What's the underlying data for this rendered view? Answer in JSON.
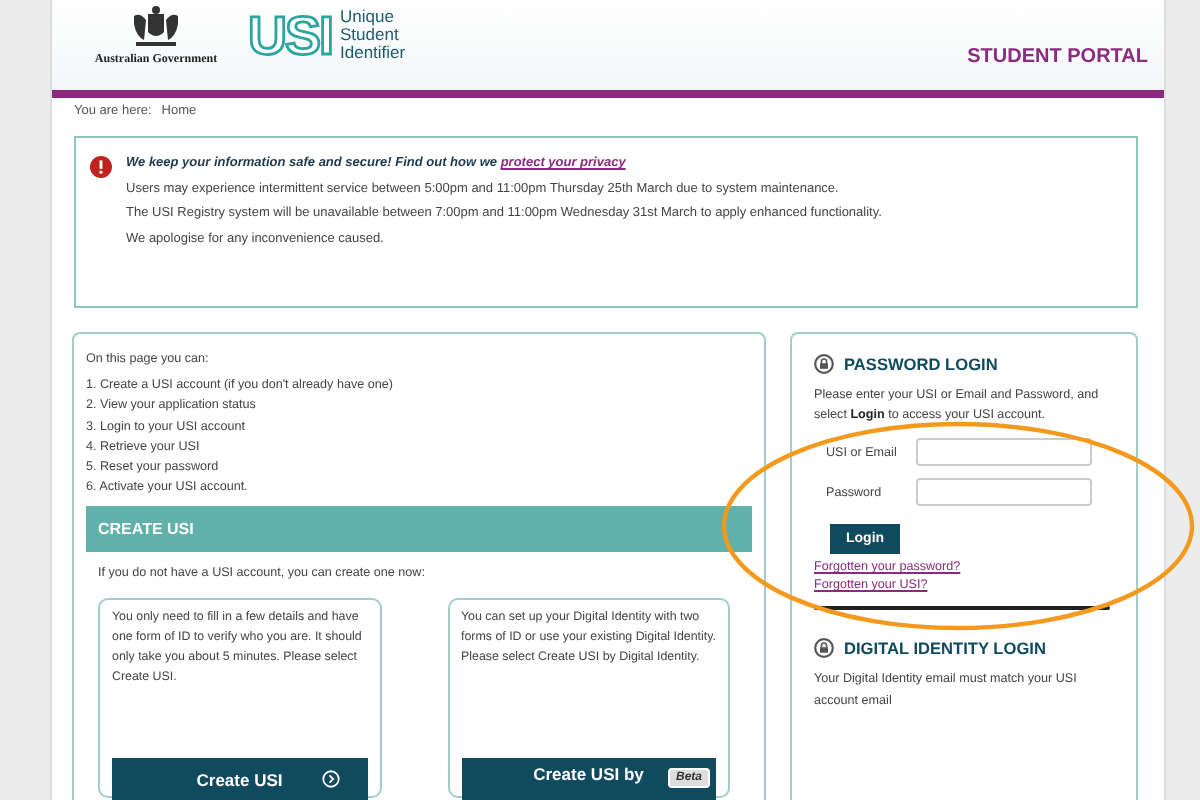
{
  "header": {
    "gov_label": "Australian Government",
    "logo_mark": "USI",
    "logo_lines": [
      "Unique",
      "Student",
      "Identifier"
    ],
    "portal_title": "STUDENT PORTAL"
  },
  "breadcrumb": {
    "label": "You are here:",
    "current": "Home"
  },
  "notice": {
    "headline": "We keep your information safe and secure! Find out how we ",
    "link": "protect your privacy",
    "lines": [
      "Users may experience intermittent service between 5:00pm and 11:00pm Thursday 25th March due to system maintenance.",
      "The USI Registry system will be unavailable between 7:00pm and 11:00pm Wednesday 31st March to apply enhanced functionality.",
      "We apologise for any inconvenience caused."
    ]
  },
  "intro": {
    "lead": "On this page you can:",
    "items": [
      "1. Create a USI account (if you don't already have one)",
      "2. View your application status",
      "3. Login to your USI account",
      "4. Retrieve your USI",
      "5. Reset your password",
      "6. Activate your USI account."
    ]
  },
  "create": {
    "heading": "CREATE USI",
    "lead": "If you do not have a USI account, you can create one now:",
    "options": [
      {
        "text": "You only need to fill in a few details and have one form of ID to verify who you are. It should only take you about 5 minutes. Please select Create USI.",
        "button": "Create USI",
        "kind": "arrow"
      },
      {
        "text": "You can set up your Digital Identity with two forms of ID or use your existing Digital Identity. Please select Create USI by Digital Identity.",
        "button": "Create USI by",
        "badge": "Beta",
        "kind": "beta"
      }
    ]
  },
  "password_login": {
    "heading": "PASSWORD LOGIN",
    "intro": "Please enter your USI or Email and Password, and select **Login** to access your USI account.",
    "fields": [
      {
        "label": "USI or Email"
      },
      {
        "label": "Password"
      }
    ],
    "button": "Login",
    "links": [
      "Forgotten your password?",
      "Forgotten your USI?"
    ]
  },
  "digital_login": {
    "heading": "DIGITAL IDENTITY LOGIN",
    "text": "Your Digital Identity email must match your USI account email"
  },
  "annotation": {
    "kind": "ellipse"
  }
}
